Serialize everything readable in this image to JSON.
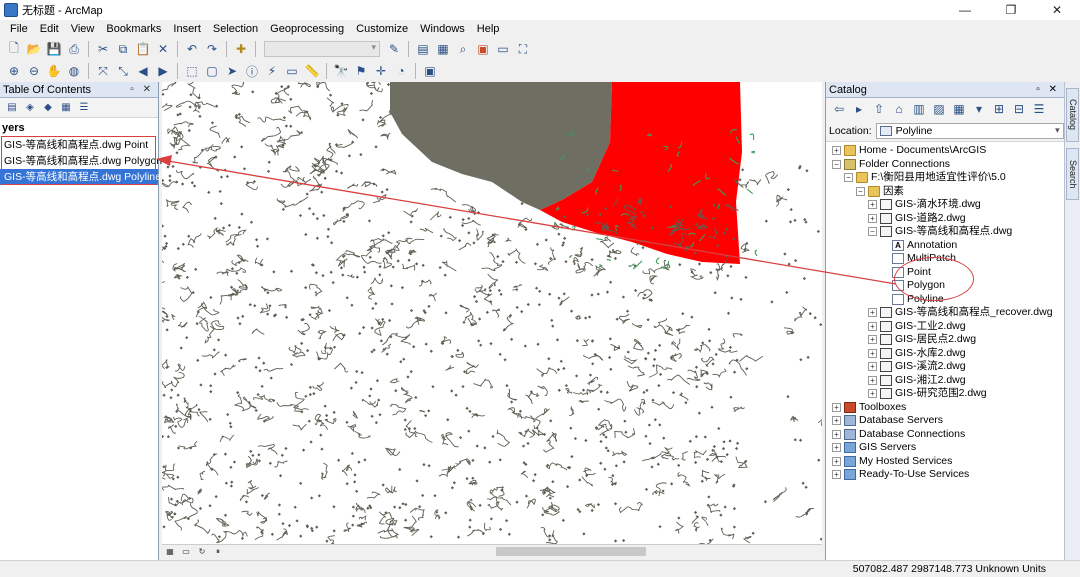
{
  "window": {
    "title": "无标题 - ArcMap",
    "min_glyph": "—",
    "max_glyph": "❐",
    "close_glyph": "✕"
  },
  "menu": [
    "File",
    "Edit",
    "View",
    "Bookmarks",
    "Insert",
    "Selection",
    "Geoprocessing",
    "Customize",
    "Windows",
    "Help"
  ],
  "toolbar1_icons": [
    "new-document-icon",
    "open-icon",
    "save-icon",
    "print-icon",
    "cut-icon",
    "copy-icon",
    "paste-icon",
    "delete-icon",
    "undo-icon",
    "redo-icon",
    "add-data-icon",
    "map-scale-dropdown",
    "editor-icon",
    "table-of-contents-icon",
    "catalog-icon",
    "search-window-icon",
    "arctoolbox-icon",
    "python-icon",
    "model-builder-icon"
  ],
  "toolbar2_icons": [
    "zoom-in-icon",
    "zoom-out-icon",
    "pan-icon",
    "full-extent-icon",
    "fixed-zoom-in-icon",
    "fixed-zoom-out-icon",
    "back-extent-icon",
    "forward-extent-icon",
    "select-features-icon",
    "clear-selection-icon",
    "select-elements-icon",
    "identify-icon",
    "hyperlink-icon",
    "html-popup-icon",
    "measure-icon",
    "find-icon",
    "find-route-icon",
    "go-to-xy-icon",
    "time-slider-icon",
    "create-viewer-window-icon"
  ],
  "toc": {
    "title": "Table Of Contents",
    "header_buttons": "▫ ✕",
    "group_label": "yers",
    "layers": [
      {
        "label": "GIS-等高线和高程点.dwg Point",
        "selected": false
      },
      {
        "label": "GIS-等高线和高程点.dwg Polygon",
        "selected": false
      },
      {
        "label": "GIS-等高线和高程点.dwg Polyline",
        "selected": true
      }
    ]
  },
  "catalog": {
    "title": "Catalog",
    "header_buttons": "▫ ✕",
    "location_label": "Location:",
    "location_value": "Polyline",
    "tree": [
      {
        "label": "Home - Documents\\ArcGIS",
        "indent": 0,
        "exp": "+",
        "icon": "home"
      },
      {
        "label": "Folder Connections",
        "indent": 0,
        "exp": "−",
        "icon": "fconn"
      },
      {
        "label": "F:\\衡阳县用地适宜性评价\\5.0",
        "indent": 1,
        "exp": "−",
        "icon": "folder"
      },
      {
        "label": "因素",
        "indent": 2,
        "exp": "−",
        "icon": "folder"
      },
      {
        "label": "GIS-滴水环境.dwg",
        "indent": 3,
        "exp": "+",
        "icon": "cad"
      },
      {
        "label": "GIS-道路2.dwg",
        "indent": 3,
        "exp": "+",
        "icon": "cad"
      },
      {
        "label": "GIS-等高线和高程点.dwg",
        "indent": 3,
        "exp": "−",
        "icon": "cad"
      },
      {
        "label": "Annotation",
        "indent": 4,
        "exp": "",
        "icon": "anno"
      },
      {
        "label": "MultiPatch",
        "indent": 4,
        "exp": "",
        "icon": "fc"
      },
      {
        "label": "Point",
        "indent": 4,
        "exp": "",
        "icon": "fc"
      },
      {
        "label": "Polygon",
        "indent": 4,
        "exp": "",
        "icon": "fc"
      },
      {
        "label": "Polyline",
        "indent": 4,
        "exp": "",
        "icon": "fc"
      },
      {
        "label": "GIS-等高线和高程点_recover.dwg",
        "indent": 3,
        "exp": "+",
        "icon": "cad"
      },
      {
        "label": "GIS-工业2.dwg",
        "indent": 3,
        "exp": "+",
        "icon": "cad"
      },
      {
        "label": "GIS-居民点2.dwg",
        "indent": 3,
        "exp": "+",
        "icon": "cad"
      },
      {
        "label": "GIS-水库2.dwg",
        "indent": 3,
        "exp": "+",
        "icon": "cad"
      },
      {
        "label": "GIS-溪流2.dwg",
        "indent": 3,
        "exp": "+",
        "icon": "cad"
      },
      {
        "label": "GIS-湘江2.dwg",
        "indent": 3,
        "exp": "+",
        "icon": "cad"
      },
      {
        "label": "GIS-研究范围2.dwg",
        "indent": 3,
        "exp": "+",
        "icon": "cad"
      },
      {
        "label": "Toolboxes",
        "indent": 0,
        "exp": "+",
        "icon": "toolbox"
      },
      {
        "label": "Database Servers",
        "indent": 0,
        "exp": "+",
        "icon": "db"
      },
      {
        "label": "Database Connections",
        "indent": 0,
        "exp": "+",
        "icon": "db"
      },
      {
        "label": "GIS Servers",
        "indent": 0,
        "exp": "+",
        "icon": "gis"
      },
      {
        "label": "My Hosted Services",
        "indent": 0,
        "exp": "+",
        "icon": "gis"
      },
      {
        "label": "Ready-To-Use Services",
        "indent": 0,
        "exp": "+",
        "icon": "gis"
      }
    ]
  },
  "side_tabs": [
    "Catalog",
    "Search"
  ],
  "status": {
    "coordinates": "507082.487  2987148.773 Unknown Units"
  },
  "colors": {
    "contour": "#5e5e52",
    "dense_polygon": "#6f6e63",
    "red_selection": "#ff0000",
    "green_contour": "#3f9b5a",
    "annotation_red": "#d94040",
    "selected_row": "#3574d6"
  }
}
